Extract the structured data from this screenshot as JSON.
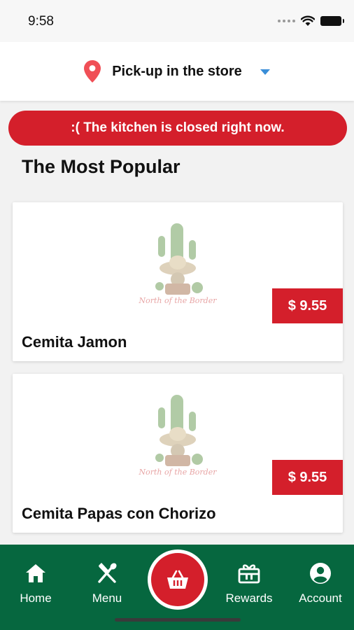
{
  "status_bar": {
    "time": "9:58"
  },
  "location": {
    "label": "Pick-up in the store",
    "icon": "location-pin-icon"
  },
  "banner": {
    "text": ":( The kitchen is closed right now."
  },
  "section": {
    "title": "The Most Popular"
  },
  "products": [
    {
      "name": "Cemita Jamon",
      "price": "$ 9.55",
      "image_caption": "North of the Border"
    },
    {
      "name": "Cemita Papas con Chorizo",
      "price": "$ 9.55",
      "image_caption": "North of the Border"
    }
  ],
  "nav": {
    "items": [
      {
        "label": "Home",
        "icon": "home-icon"
      },
      {
        "label": "Menu",
        "icon": "utensils-icon"
      },
      {
        "label": "Rewards",
        "icon": "gift-icon"
      },
      {
        "label": "Account",
        "icon": "account-icon"
      }
    ],
    "cart_icon": "basket-icon"
  },
  "colors": {
    "accent_red": "#d41f2b",
    "nav_green": "#06673f",
    "pin_red": "#f04f56",
    "caret_blue": "#3a8ed8"
  }
}
